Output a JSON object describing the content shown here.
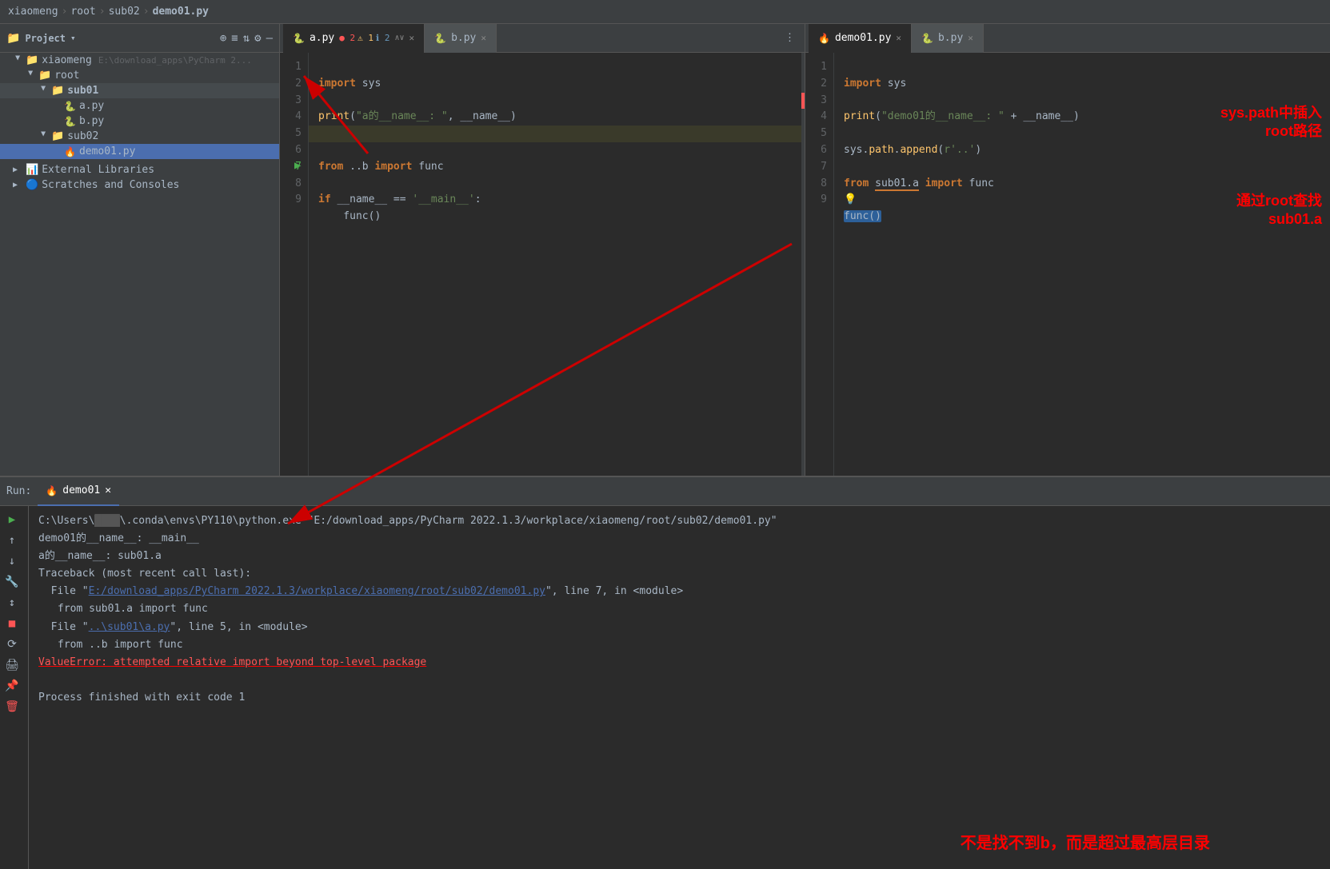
{
  "titlebar": {
    "breadcrumb": [
      "xiaomeng",
      "root",
      "sub02",
      "demo01.py"
    ]
  },
  "sidebar": {
    "title": "Project",
    "root": "xiaomeng",
    "rootPath": "E:\\download_apps\\PyCharm 2...",
    "tree": [
      {
        "id": "root",
        "label": "root",
        "type": "folder",
        "level": 1,
        "open": true
      },
      {
        "id": "sub01",
        "label": "sub01",
        "type": "folder",
        "level": 2,
        "open": true,
        "highlighted": true
      },
      {
        "id": "a.py",
        "label": "a.py",
        "type": "pyfile",
        "level": 3
      },
      {
        "id": "b.py",
        "label": "b.py",
        "type": "pyfile",
        "level": 3
      },
      {
        "id": "sub02",
        "label": "sub02",
        "type": "folder",
        "level": 2,
        "open": true
      },
      {
        "id": "demo01.py",
        "label": "demo01.py",
        "type": "pyfile-special",
        "level": 3
      },
      {
        "id": "ext-libs",
        "label": "External Libraries",
        "type": "ext",
        "level": 1
      },
      {
        "id": "scratches",
        "label": "Scratches and Consoles",
        "type": "scratches",
        "level": 1
      }
    ]
  },
  "editor_left": {
    "tab_label": "a.py",
    "errors": {
      "errors": 2,
      "warnings": 1,
      "info": 2
    },
    "lines": [
      {
        "num": 1,
        "code": "import sys"
      },
      {
        "num": 2,
        "code": ""
      },
      {
        "num": 3,
        "code": "print(\"a的__name__: \", __name__)"
      },
      {
        "num": 4,
        "code": ""
      },
      {
        "num": 5,
        "code": "from ..b import func"
      },
      {
        "num": 6,
        "code": ""
      },
      {
        "num": 7,
        "code": "if __name__ == '__main__':"
      },
      {
        "num": 8,
        "code": "    func()"
      },
      {
        "num": 9,
        "code": ""
      }
    ]
  },
  "editor_right": {
    "tab1_label": "demo01.py",
    "tab2_label": "b.py",
    "lines": [
      {
        "num": 1,
        "code": "import sys"
      },
      {
        "num": 2,
        "code": ""
      },
      {
        "num": 3,
        "code": "print(\"demo01的__name__: \" + __name__)"
      },
      {
        "num": 4,
        "code": ""
      },
      {
        "num": 5,
        "code": "sys.path.append(r'..')"
      },
      {
        "num": 6,
        "code": ""
      },
      {
        "num": 7,
        "code": "from sub01.a import func"
      },
      {
        "num": 8,
        "code": ""
      },
      {
        "num": 9,
        "code": "func()"
      }
    ],
    "annotation1": "sys.path中插入\nroot路径",
    "annotation2": "通过root查找\nsub01.a"
  },
  "run_panel": {
    "tab_label": "demo01",
    "cmd_line": "C:\\Users\\    \\.conda\\envs\\PY110\\python.exe \"E:/download_apps/PyCharm 2022.1.3/workplace/xiaomeng/root/sub02/demo01.py\"",
    "output": [
      "demo01的__name__: __main__",
      "a的__name__:  sub01.a",
      "Traceback (most recent call last):",
      "  File \"E:/download_apps/PyCharm 2022.1.3/workplace/xiaomeng/root/sub02/demo01.py\", line 7, in <module>",
      "    from sub01.a import func",
      "  File \"..\\sub01\\a.py\", line 5, in <module>",
      "    from ..b import func",
      "ValueError: attempted relative import beyond top-level package",
      "",
      "Process finished with exit code 1"
    ],
    "link1": "E:/download_apps/PyCharm 2022.1.3/workplace/xiaomeng/root/sub02/demo01.py",
    "link2": "..\\sub01\\a.py",
    "bottom_annotation": "不是找不到b，而是超过最高层目录"
  }
}
